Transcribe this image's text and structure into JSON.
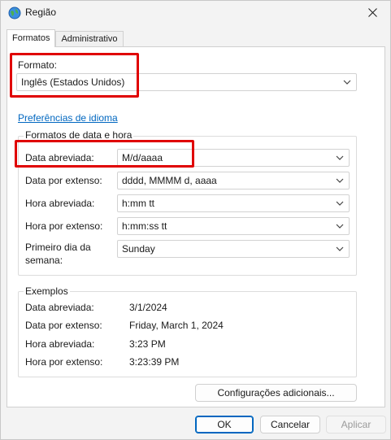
{
  "window": {
    "title": "Região",
    "icon": "globe-icon"
  },
  "tabs": [
    {
      "label": "Formatos",
      "active": true
    },
    {
      "label": "Administrativo",
      "active": false
    }
  ],
  "format": {
    "label": "Formato:",
    "value": "Inglês (Estados Unidos)"
  },
  "language_link": "Preferências de idioma",
  "date_time": {
    "legend": "Formatos de data e hora",
    "rows": [
      {
        "label": "Data abreviada:",
        "value": "M/d/aaaa"
      },
      {
        "label": "Data por extenso:",
        "value": "dddd, MMMM d, aaaa"
      },
      {
        "label": "Hora abreviada:",
        "value": "h:mm tt"
      },
      {
        "label": "Hora por extenso:",
        "value": "h:mm:ss tt"
      },
      {
        "label_line1": "Primeiro dia da",
        "label_line2": "semana:",
        "value": "Sunday"
      }
    ]
  },
  "examples": {
    "legend": "Exemplos",
    "rows": [
      {
        "label": "Data abreviada:",
        "value": "3/1/2024"
      },
      {
        "label": "Data por extenso:",
        "value": "Friday, March 1, 2024"
      },
      {
        "label": "Hora abreviada:",
        "value": "3:23 PM"
      },
      {
        "label": "Hora por extenso:",
        "value": "3:23:39 PM"
      }
    ]
  },
  "buttons": {
    "additional": "Configurações adicionais...",
    "ok": "OK",
    "cancel": "Cancelar",
    "apply": "Aplicar"
  },
  "colors": {
    "accent": "#0067c0",
    "highlight": "#e00000"
  }
}
